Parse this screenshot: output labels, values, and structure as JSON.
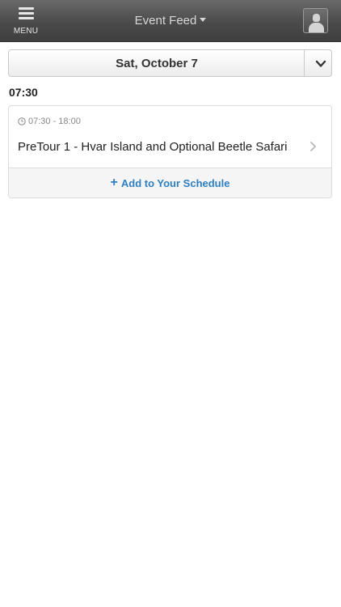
{
  "header": {
    "menu_label": "MENU",
    "title": "Event Feed",
    "icons": {
      "menu": "hamburger-icon",
      "title_dropdown": "caret-down-icon",
      "profile": "profile-avatar-icon"
    }
  },
  "date_selector": {
    "selected": "Sat, October 7",
    "icon": "chevron-down-icon"
  },
  "schedule": {
    "time_group": "07:30",
    "events": [
      {
        "time_range": "07:30 - 18:00",
        "name": "PreTour 1 - Hvar Island and Optional Beetle Safari",
        "action_label": "Add to Your Schedule",
        "icons": {
          "time": "clock-icon",
          "open": "chevron-right-icon",
          "action": "plus-icon"
        }
      }
    ]
  },
  "colors": {
    "header_bg": "#4a4a4a",
    "accent": "#2d7fc1",
    "card_border": "#dcdcdc"
  }
}
